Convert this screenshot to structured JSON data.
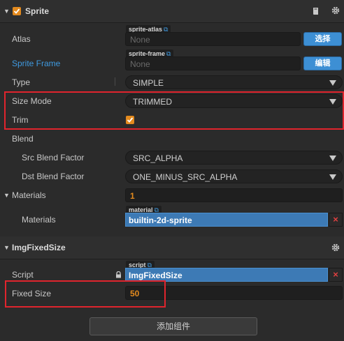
{
  "sprite": {
    "title": "Sprite",
    "atlas": {
      "label": "Atlas",
      "tag": "sprite-atlas",
      "value": "None",
      "button": "选择"
    },
    "sprite_frame": {
      "label": "Sprite Frame",
      "tag": "sprite-frame",
      "value": "None",
      "button": "编辑"
    },
    "type": {
      "label": "Type",
      "value": "SIMPLE"
    },
    "size_mode": {
      "label": "Size Mode",
      "value": "TRIMMED"
    },
    "trim": {
      "label": "Trim",
      "checked": true
    },
    "blend": {
      "label": "Blend"
    },
    "src_blend": {
      "label": "Src Blend Factor",
      "value": "SRC_ALPHA"
    },
    "dst_blend": {
      "label": "Dst Blend Factor",
      "value": "ONE_MINUS_SRC_ALPHA"
    },
    "materials_count": {
      "label": "Materials",
      "value": "1"
    },
    "materials": {
      "label": "Materials",
      "tag": "material",
      "value": "builtin-2d-sprite"
    }
  },
  "img_fixed_size": {
    "title": "ImgFixedSize",
    "script": {
      "label": "Script",
      "tag": "script",
      "value": "ImgFixedSize"
    },
    "fixed_size": {
      "label": "Fixed Size",
      "value": "50"
    }
  },
  "add_component": {
    "label": "添加组件"
  },
  "colors": {
    "accent_orange": "#e38a1e",
    "link_blue": "#3f9ae0",
    "highlight_red": "#e0242d",
    "button_blue": "#3d8fd4"
  }
}
